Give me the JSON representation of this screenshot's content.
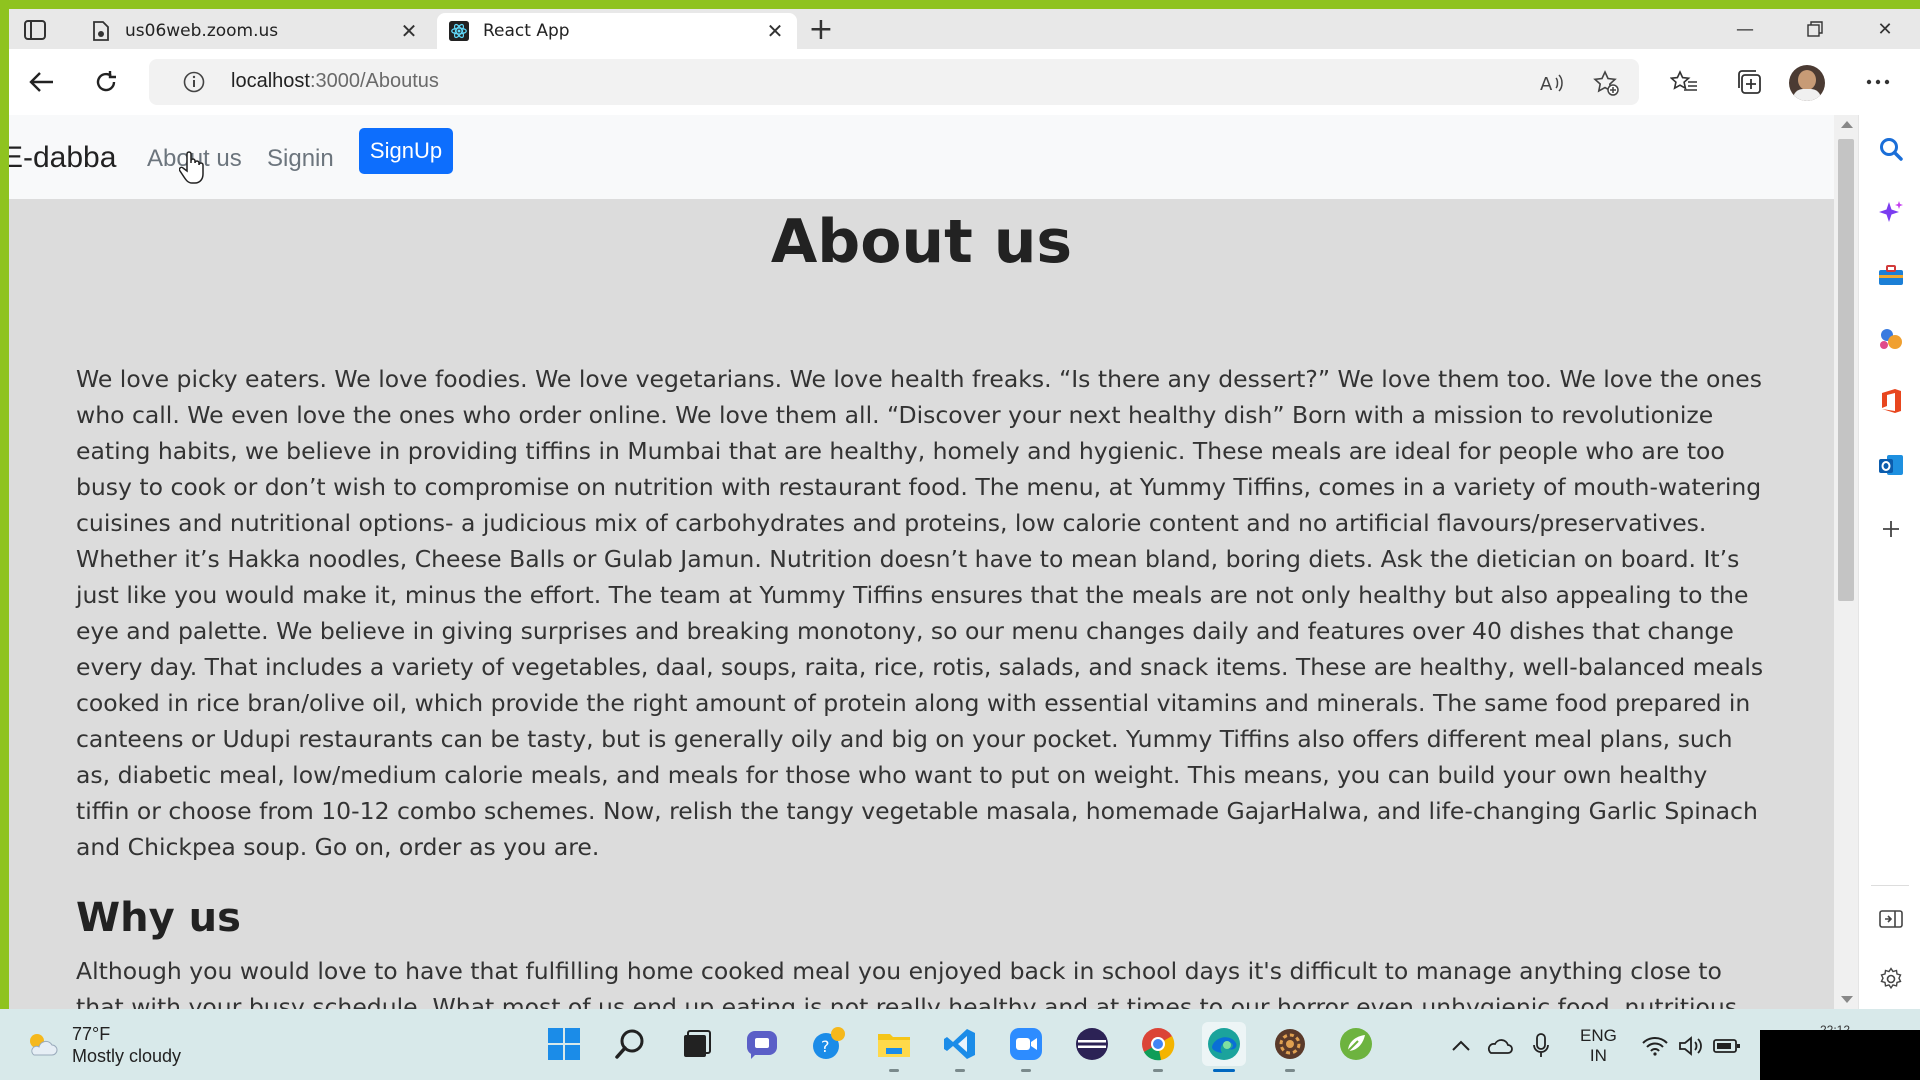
{
  "browser": {
    "tabs": [
      {
        "title": "us06web.zoom.us",
        "active": false,
        "favicon": "zoom-doc-icon"
      },
      {
        "title": "React App",
        "active": true,
        "favicon": "react-icon"
      }
    ],
    "address": {
      "host": "localhost",
      "path": ":3000/Aboutus"
    }
  },
  "navbar": {
    "brand": "E-dabba",
    "links": {
      "about": "About us",
      "signin": "Signin"
    },
    "signup": "SignUp"
  },
  "page": {
    "title": "About us",
    "about_text": "We love picky eaters. We love foodies. We love vegetarians. We love health freaks. “Is there any dessert?” We love them too. We love the ones who call. We even love the ones who order online. We love them all. “Discover your next healthy dish” Born with a mission to revolutionize eating habits, we believe in providing tiffins in Mumbai that are healthy, homely and hygienic. These meals are ideal for people who are too busy to cook or don’t wish to compromise on nutrition with restaurant food. The menu, at Yummy Tiffins, comes in a variety of mouth-watering cuisines and nutritional options- a judicious mix of carbohydrates and proteins, low calorie content and no artificial flavours/preservatives. Whether it’s Hakka noodles, Cheese Balls or Gulab Jamun. Nutrition doesn’t have to mean bland, boring diets. Ask the dietician on board. It’s just like you would make it, minus the effort. The team at Yummy Tiffins ensures that the meals are not only healthy but also appealing to the eye and palette. We believe in giving surprises and breaking monotony, so our menu changes daily and features over 40 dishes that change every day. That includes a variety of vegetables, daal, soups, raita, rice, rotis, salads, and snack items. These are healthy, well-balanced meals cooked in rice bran/olive oil, which provide the right amount of protein along with essential vitamins and minerals. The same food prepared in canteens or Udupi restaurants can be tasty, but is generally oily and big on your pocket. Yummy Tiffins also offers different meal plans, such as, diabetic meal, low/medium calorie meals, and meals for those who want to put on weight. This means, you can build your own healthy tiffin or choose from 10-12 combo schemes. Now, relish the tangy vegetable masala, homemade GajarHalwa, and life-changing Garlic Spinach and Chickpea soup. Go on, order as you are.",
    "why_heading": "Why us",
    "why_text": "Although you would love to have that fulfilling home cooked meal you enjoyed back in school days it's difficult to manage anything close to that with your busy schedule. What most of us end up eating is not really healthy and at times to our horror even unhygienic food, nutritious meal has become \"out of sight"
  },
  "taskbar": {
    "weather": {
      "temp": "77°F",
      "condition": "Mostly cloudy"
    },
    "lang": {
      "line1": "ENG",
      "line2": "IN"
    },
    "clock": "22:12"
  },
  "colors": {
    "accent": "#0d6efd",
    "page_bg": "#dcdcdc",
    "navbar_bg": "#f8f9fa"
  }
}
